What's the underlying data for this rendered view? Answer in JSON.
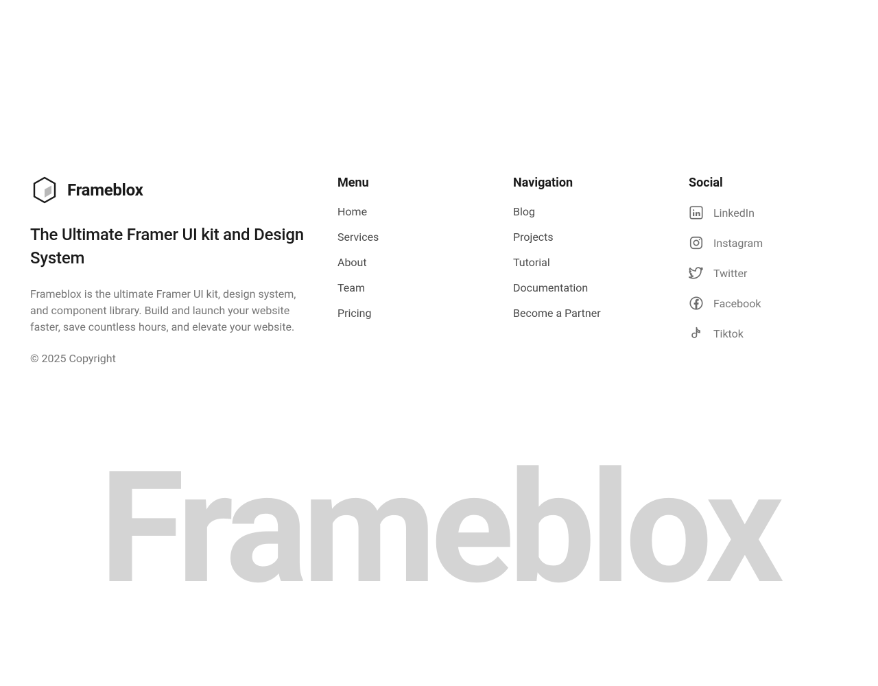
{
  "brand": {
    "name": "Frameblox",
    "headline": "The Ultimate Framer UI kit and Design System",
    "description": "Frameblox is the ultimate Framer UI kit, design system, and component library. Build and launch your website faster, save countless hours, and elevate your website.",
    "copyright": "© 2025 Copyright"
  },
  "menu": {
    "title": "Menu",
    "items": [
      "Home",
      "Services",
      "About",
      "Team",
      "Pricing"
    ]
  },
  "navigation": {
    "title": "Navigation",
    "items": [
      "Blog",
      "Projects",
      "Tutorial",
      "Documentation",
      "Become a Partner"
    ]
  },
  "social": {
    "title": "Social",
    "items": [
      {
        "label": "LinkedIn",
        "icon": "linkedin"
      },
      {
        "label": "Instagram",
        "icon": "instagram"
      },
      {
        "label": "Twitter",
        "icon": "twitter"
      },
      {
        "label": "Facebook",
        "icon": "facebook"
      },
      {
        "label": "Tiktok",
        "icon": "tiktok"
      }
    ]
  },
  "bigBrand": "Frameblox"
}
